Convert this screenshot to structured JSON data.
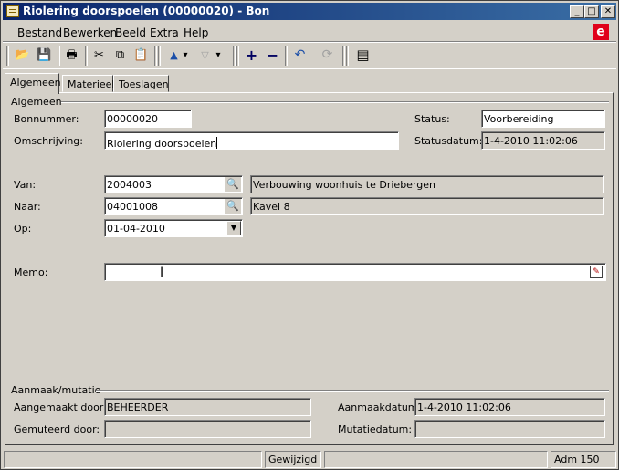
{
  "window": {
    "title": "Riolering doorspoelen (00000020) - Bon",
    "min_glyph": "_",
    "max_glyph": "□",
    "close_glyph": "✕"
  },
  "menu": {
    "items": [
      "Bestand",
      "Bewerken",
      "Beeld",
      "Extra",
      "Help"
    ],
    "brand_glyph": "e"
  },
  "toolbar": {
    "icons": [
      "open-folder-icon",
      "save-icon",
      "print-icon",
      "cut-icon",
      "copy-icon",
      "paste-icon",
      "arrow-up-icon",
      "arrow-down-icon",
      "add-icon",
      "remove-icon",
      "undo-icon",
      "refresh-icon",
      "layout-icon"
    ],
    "glyphs": {
      "open": "📂",
      "save": "💾",
      "print": "🖶",
      "cut": "✂",
      "copy": "⧉",
      "paste": "📋",
      "up": "▲",
      "up_menu": "▾",
      "down": "▽",
      "down_menu": "▾",
      "add": "+",
      "remove": "−",
      "undo": "↶",
      "refresh": "⟳",
      "layout": "▤"
    }
  },
  "tabs": [
    {
      "label": "Algemeen",
      "active": true
    },
    {
      "label": "Materieel",
      "active": false
    },
    {
      "label": "Toeslagen",
      "active": false
    }
  ],
  "section_general": {
    "title": "Algemeen",
    "bonnummer_label": "Bonnummer:",
    "bonnummer_value": "00000020",
    "omschrijving_label": "Omschrijving:",
    "omschrijving_value": "Riolering doorspoelen",
    "status_label": "Status:",
    "status_value": "Voorbereiding",
    "statusdatum_label": "Statusdatum:",
    "statusdatum_value": "1-4-2010 11:02:06",
    "van_label": "Van:",
    "van_code": "2004003",
    "van_desc": "Verbouwing woonhuis te Driebergen",
    "naar_label": "Naar:",
    "naar_code": "04001008",
    "naar_desc": "Kavel 8",
    "op_label": "Op:",
    "op_value": "01-04-2010",
    "memo_label": "Memo:",
    "memo_value": "",
    "lookup_glyph": "🔍",
    "dropdown_glyph": "▼",
    "memo_edit_glyph": "✎"
  },
  "section_audit": {
    "title": "Aanmaak/mutatie",
    "created_by_label": "Aangemaakt door:",
    "created_by_value": "BEHEERDER",
    "modified_by_label": "Gemuteerd door:",
    "modified_by_value": "",
    "created_date_label": "Aanmaakdatum:",
    "created_date_value": "1-4-2010 11:02:06",
    "modified_date_label": "Mutatiedatum:",
    "modified_date_value": ""
  },
  "statusbar": {
    "panel1": "",
    "panel2": "Gewijzigd",
    "panel3": "",
    "panel4": "Adm 150"
  }
}
